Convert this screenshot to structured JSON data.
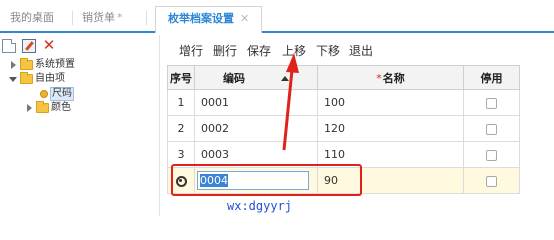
{
  "tabs": [
    {
      "label": "我的桌面"
    },
    {
      "label": "销货单",
      "close": "*"
    },
    {
      "label": "枚举档案设置",
      "close": "✕"
    }
  ],
  "tree": {
    "nodes": [
      {
        "label": "系统预置",
        "state": "collapsed"
      },
      {
        "label": "自由项",
        "state": "expanded"
      },
      {
        "label": "尺码",
        "state": "selected"
      },
      {
        "label": "颜色",
        "state": "collapsed"
      }
    ]
  },
  "toolbar": {
    "add_row": "增行",
    "delete_row": "删行",
    "save": "保存",
    "move_up": "上移",
    "move_down": "下移",
    "exit": "退出"
  },
  "grid": {
    "headers": {
      "index": "序号",
      "code": "编码",
      "name_required": "*",
      "name": "名称",
      "disabled": "停用"
    },
    "rows": [
      {
        "index": "1",
        "code": "0001",
        "name": "100",
        "disabled": false
      },
      {
        "index": "2",
        "code": "0002",
        "name": "120",
        "disabled": false
      },
      {
        "index": "3",
        "code": "0003",
        "name": "110",
        "disabled": false
      },
      {
        "index": "",
        "code": "0004",
        "name": "90",
        "disabled": false,
        "editing": true
      }
    ]
  },
  "watermark": "wx:dgyyrj",
  "colors": {
    "accent": "#2e86d6",
    "annotation": "#e0231a",
    "editing_row": "#fff9e0"
  }
}
